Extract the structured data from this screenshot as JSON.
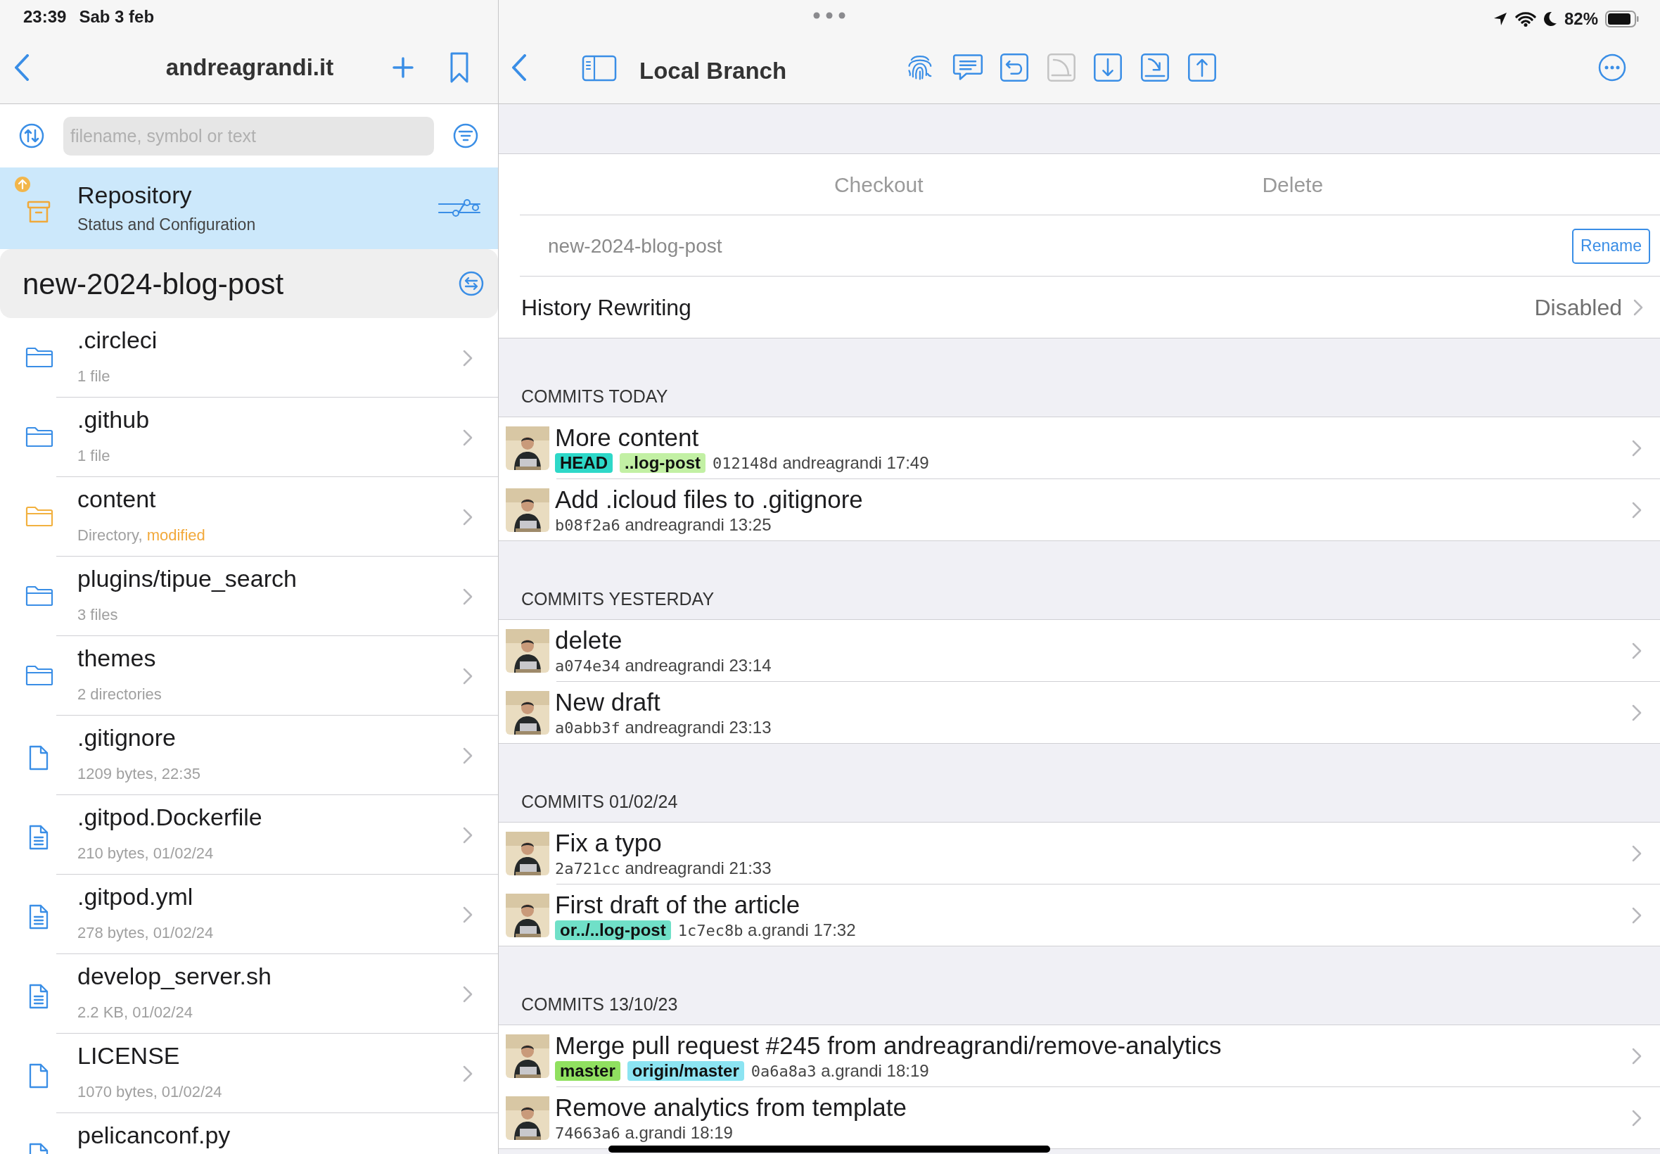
{
  "status_bar": {
    "time": "23:39",
    "date": "Sab 3 feb",
    "battery": "82%"
  },
  "sidebar": {
    "title": "andreagrandi.it",
    "search": {
      "placeholder": "filename, symbol or text"
    },
    "repository": {
      "title": "Repository",
      "subtitle": "Status and Configuration",
      "selected": true
    },
    "branch": "new-2024-blog-post",
    "items": [
      {
        "kind": "folder",
        "name": ".circleci",
        "detail": "1 file",
        "modified": false
      },
      {
        "kind": "folder",
        "name": ".github",
        "detail": "1 file",
        "modified": false
      },
      {
        "kind": "folder",
        "name": "content",
        "detail": "Directory,",
        "modified": true,
        "status": "modified"
      },
      {
        "kind": "folder",
        "name": "plugins/tipue_search",
        "detail": "3 files",
        "modified": false
      },
      {
        "kind": "folder",
        "name": "themes",
        "detail": "2 directories",
        "modified": false
      },
      {
        "kind": "file",
        "name": ".gitignore",
        "detail": "1209 bytes, 22:35",
        "modified": false
      },
      {
        "kind": "text",
        "name": ".gitpod.Dockerfile",
        "detail": "210 bytes, 01/02/24",
        "modified": false
      },
      {
        "kind": "text",
        "name": ".gitpod.yml",
        "detail": "278 bytes, 01/02/24",
        "modified": false
      },
      {
        "kind": "text",
        "name": "develop_server.sh",
        "detail": "2.2 KB, 01/02/24",
        "modified": false
      },
      {
        "kind": "file",
        "name": "LICENSE",
        "detail": "1070 bytes, 01/02/24",
        "modified": false
      },
      {
        "kind": "file",
        "name": "pelicanconf.py",
        "modified": false
      }
    ]
  },
  "main": {
    "title": "Local Branch",
    "toolbar": [
      {
        "kind": "fingerprint",
        "disabled": false
      },
      {
        "kind": "message",
        "disabled": false
      },
      {
        "kind": "undo",
        "disabled": false
      },
      {
        "kind": "merge",
        "disabled": true
      },
      {
        "kind": "pull",
        "disabled": false
      },
      {
        "kind": "fetch",
        "disabled": false
      },
      {
        "kind": "push",
        "disabled": false
      }
    ],
    "actions": [
      "Checkout",
      "Delete"
    ],
    "branch_name": "new-2024-blog-post",
    "rename": "Rename",
    "history": {
      "label": "History Rewriting",
      "value": "Disabled"
    },
    "sections": [
      {
        "header": "COMMITS TODAY",
        "commits": [
          {
            "title": "More content",
            "tags": [
              {
                "label": "HEAD",
                "color": "#2ed8c8"
              },
              {
                "label": "..log-post",
                "color": "#c2f0a4"
              }
            ],
            "hash": "012148d",
            "meta": "andreagrandi 17:49"
          },
          {
            "title": "Add .icloud files to .gitignore",
            "hash": "b08f2a6",
            "meta": "andreagrandi 13:25"
          }
        ]
      },
      {
        "header": "COMMITS YESTERDAY",
        "commits": [
          {
            "title": "delete",
            "hash": "a074e34",
            "meta": "andreagrandi 23:14"
          },
          {
            "title": "New draft",
            "hash": "a0abb3f",
            "meta": "andreagrandi 23:13"
          }
        ]
      },
      {
        "header": "COMMITS 01/02/24",
        "commits": [
          {
            "title": "Fix a typo",
            "hash": "2a721cc",
            "meta": "andreagrandi 21:33"
          },
          {
            "title": "First draft of the article",
            "tags": [
              {
                "label": "or../..log-post",
                "color": "#70e0c8"
              }
            ],
            "hash": "1c7ec8b",
            "meta": "a.grandi 17:32"
          }
        ]
      },
      {
        "header": "COMMITS 13/10/23",
        "commits": [
          {
            "title": "Merge pull request #245 from andreagrandi/remove-analytics",
            "tags": [
              {
                "label": "master",
                "color": "#90e060"
              },
              {
                "label": "origin/master",
                "color": "#8ce4f2"
              }
            ],
            "hash": "0a6a8a3",
            "meta": "a.grandi 18:19"
          },
          {
            "title": "Remove analytics from template",
            "hash": "74663a6",
            "meta": "a.grandi 18:19"
          }
        ]
      }
    ]
  }
}
